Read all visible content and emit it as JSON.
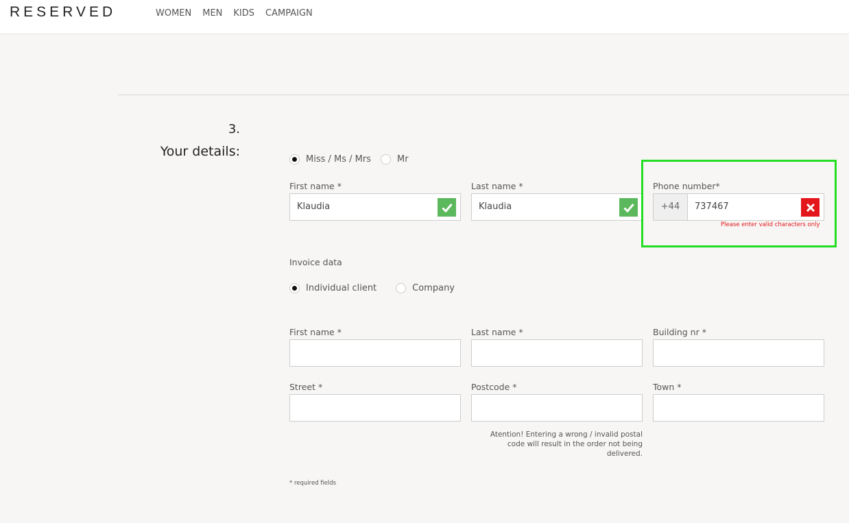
{
  "header": {
    "logo": "RESERVED",
    "nav": [
      "WOMEN",
      "MEN",
      "KIDS",
      "CAMPAIGN"
    ]
  },
  "step": {
    "number": "3.",
    "title": "Your details:"
  },
  "title_options": [
    {
      "label": "Miss / Ms / Mrs",
      "selected": true
    },
    {
      "label": "Mr",
      "selected": false
    }
  ],
  "contact": {
    "first_name": {
      "label": "First name *",
      "value": "Klaudia",
      "status": "valid"
    },
    "last_name": {
      "label": "Last name *",
      "value": "Klaudia",
      "status": "valid"
    },
    "phone": {
      "label": "Phone number*",
      "prefix": "+44",
      "value": "737467",
      "status": "invalid",
      "error": "Please enter valid characters only"
    }
  },
  "invoice": {
    "heading": "Invoice data",
    "client_options": [
      {
        "label": "Individual client",
        "selected": true
      },
      {
        "label": "Company",
        "selected": false
      }
    ],
    "fields": {
      "first_name": {
        "label": "First name *",
        "value": ""
      },
      "last_name": {
        "label": "Last name *",
        "value": ""
      },
      "building": {
        "label": "Building nr *",
        "value": ""
      },
      "street": {
        "label": "Street *",
        "value": ""
      },
      "postcode": {
        "label": "Postcode *",
        "value": ""
      },
      "town": {
        "label": "Town *",
        "value": ""
      }
    },
    "postcode_note": "Atention! Entering a wrong / invalid postal code will result in the order not being delivered."
  },
  "required_note": "* required fields",
  "colors": {
    "valid": "#5cb85c",
    "invalid": "#e3161b",
    "highlight": "#22dd22"
  }
}
